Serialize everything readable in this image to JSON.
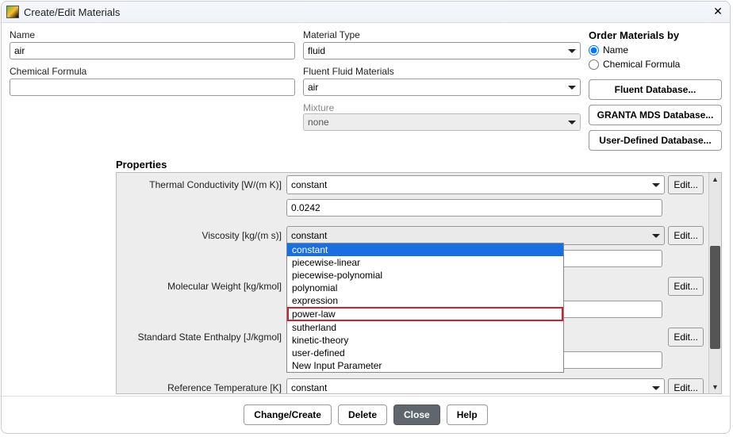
{
  "window": {
    "title": "Create/Edit Materials"
  },
  "labels": {
    "name": "Name",
    "chem_formula": "Chemical Formula",
    "material_type": "Material Type",
    "fluent_materials": "Fluent Fluid Materials",
    "mixture": "Mixture",
    "order_by": "Order Materials by",
    "properties": "Properties"
  },
  "fields": {
    "name": "air",
    "material_type": "fluid",
    "fluent_materials": "air",
    "mixture": "none",
    "chem_formula": ""
  },
  "order": {
    "name": "Name",
    "chem": "Chemical Formula",
    "selected": "name"
  },
  "db_buttons": {
    "fluent": "Fluent Database...",
    "granta": "GRANTA MDS Database...",
    "user": "User-Defined Database..."
  },
  "properties": [
    {
      "label": "Thermal Conductivity [W/(m K)]",
      "method": "constant",
      "value": "0.0242",
      "edit": "Edit..."
    },
    {
      "label": "Viscosity [kg/(m s)]",
      "method": "constant",
      "value": "",
      "edit": "Edit..."
    },
    {
      "label": "Molecular Weight [kg/kmol]",
      "method": "",
      "value": "",
      "edit": "Edit..."
    },
    {
      "label": "Standard State Enthalpy [J/kgmol]",
      "method": "",
      "value": "",
      "edit": "Edit..."
    },
    {
      "label": "Reference Temperature [K]",
      "method": "constant",
      "value": "",
      "edit": "Edit..."
    }
  ],
  "viscosity_options": [
    "constant",
    "piecewise-linear",
    "piecewise-polynomial",
    "polynomial",
    "expression",
    "power-law",
    "sutherland",
    "kinetic-theory",
    "user-defined",
    "New Input Parameter"
  ],
  "viscosity_highlight": "power-law",
  "viscosity_selected": "constant",
  "footer": {
    "change_create": "Change/Create",
    "delete": "Delete",
    "close": "Close",
    "help": "Help"
  },
  "misc": {
    "caret_up": "▲",
    "caret_down": "▼",
    "close_x": "✕"
  }
}
